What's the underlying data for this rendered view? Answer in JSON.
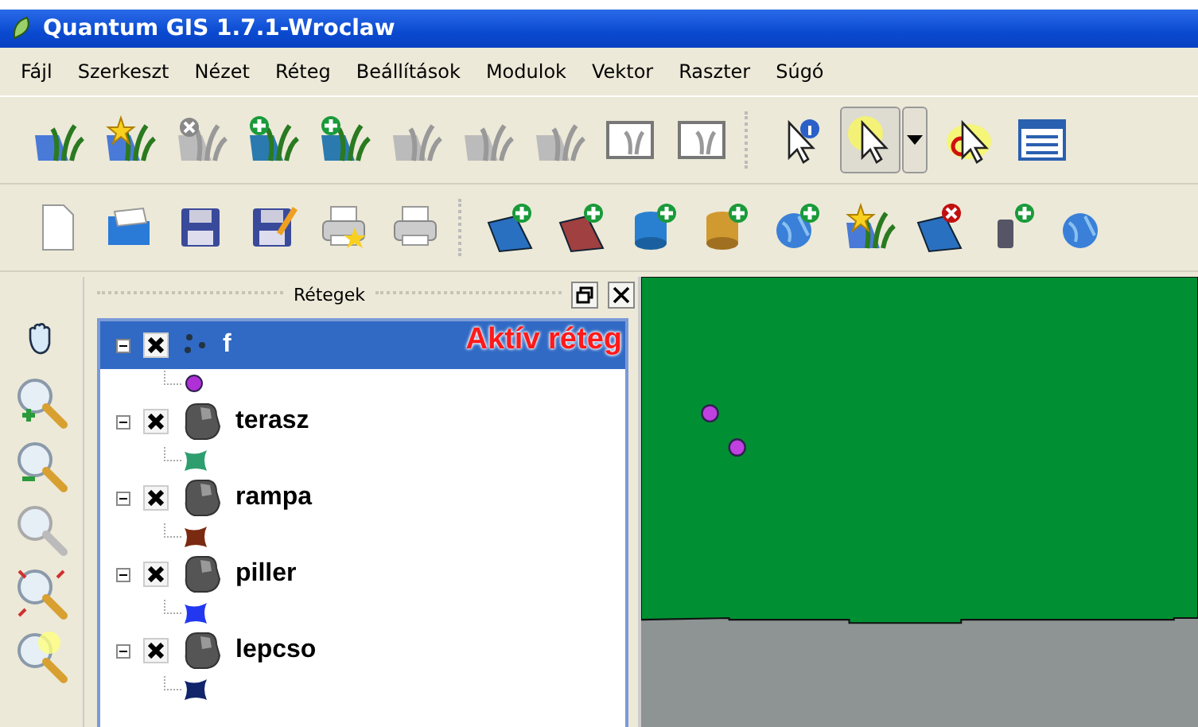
{
  "window": {
    "title": "Quantum GIS 1.7.1-Wroclaw"
  },
  "menu": [
    "Fájl",
    "Szerkeszt",
    "Nézet",
    "Réteg",
    "Beállítások",
    "Modulok",
    "Vektor",
    "Raszter",
    "Súgó"
  ],
  "layers_panel": {
    "title": "Rétegek",
    "annotation": "Aktív réteg",
    "layers": [
      {
        "name": "f",
        "kind": "point",
        "selected": true,
        "checked": true,
        "expanded": true,
        "color": "#b030d8"
      },
      {
        "name": "terasz",
        "kind": "polygon",
        "selected": false,
        "checked": true,
        "expanded": true,
        "color": "#2e9e6e"
      },
      {
        "name": "rampa",
        "kind": "polygon",
        "selected": false,
        "checked": true,
        "expanded": true,
        "color": "#7a2a10"
      },
      {
        "name": "piller",
        "kind": "polygon",
        "selected": false,
        "checked": true,
        "expanded": true,
        "color": "#2238f0"
      },
      {
        "name": "lepcso",
        "kind": "polygon",
        "selected": false,
        "checked": true,
        "expanded": true,
        "color": "#10256a"
      }
    ]
  }
}
